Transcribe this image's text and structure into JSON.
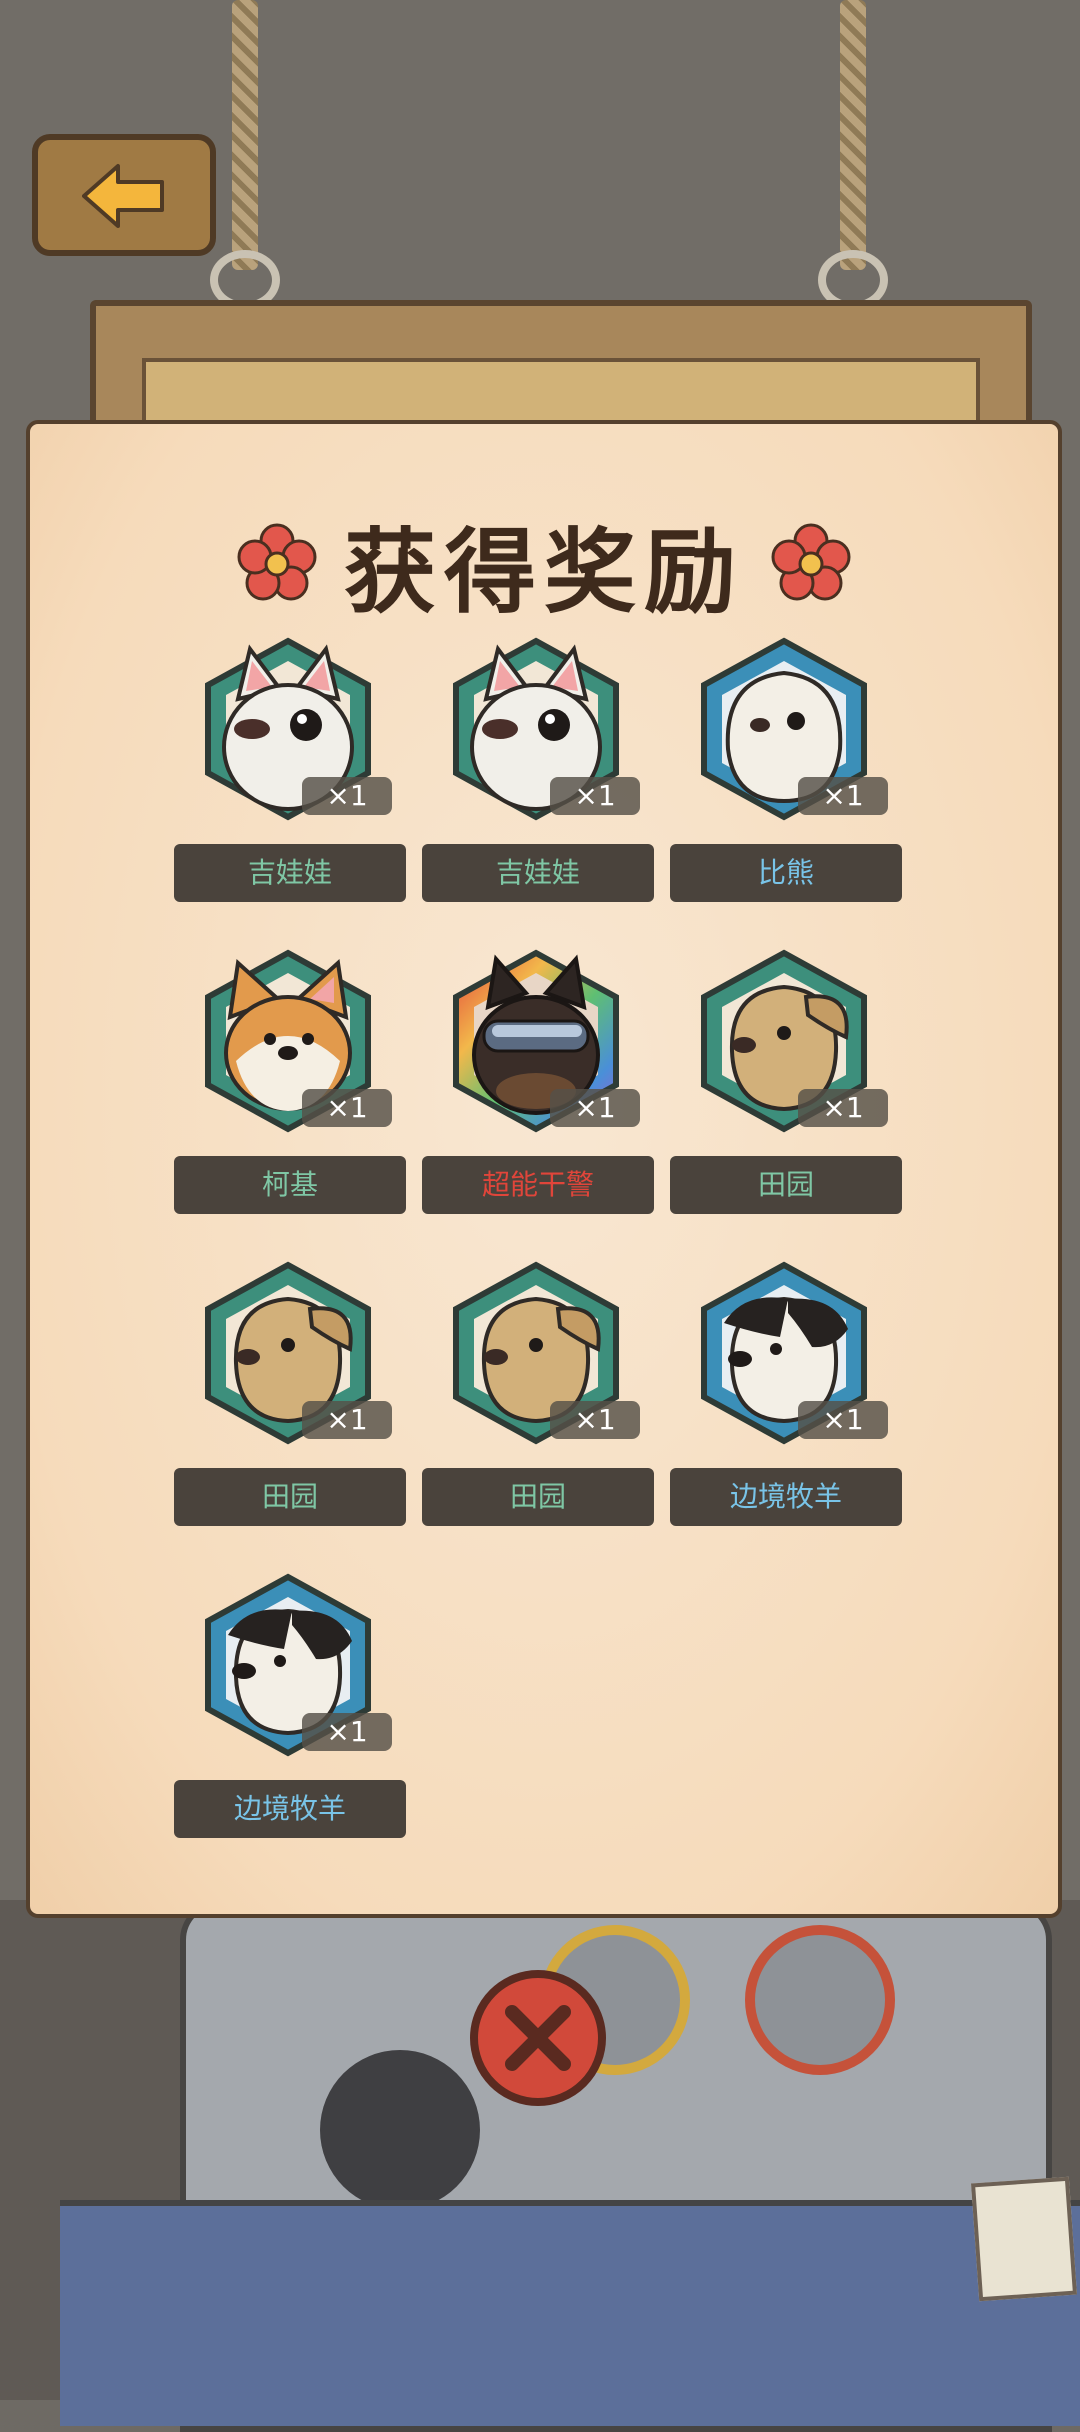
{
  "panel": {
    "title": "获得奖励"
  },
  "rewards": [
    {
      "name": "吉娃娃",
      "count": "×1",
      "name_color": "#7fc7a5",
      "frame": "#3d8f7c",
      "breed": "chihuahua"
    },
    {
      "name": "吉娃娃",
      "count": "×1",
      "name_color": "#7fc7a5",
      "frame": "#3d8f7c",
      "breed": "chihuahua"
    },
    {
      "name": "比熊",
      "count": "×1",
      "name_color": "#79c4e8",
      "frame": "#3b8fb8",
      "breed": "bichon"
    },
    {
      "name": "柯基",
      "count": "×1",
      "name_color": "#7fc7a5",
      "frame": "#3d8f7c",
      "breed": "corgi"
    },
    {
      "name": "超能干警",
      "count": "×1",
      "name_color": "#e0453a",
      "frame": "rainbow",
      "breed": "police-dog"
    },
    {
      "name": "田园",
      "count": "×1",
      "name_color": "#7fc7a5",
      "frame": "#3d8f7c",
      "breed": "rural-dog"
    },
    {
      "name": "田园",
      "count": "×1",
      "name_color": "#7fc7a5",
      "frame": "#3d8f7c",
      "breed": "rural-dog"
    },
    {
      "name": "田园",
      "count": "×1",
      "name_color": "#7fc7a5",
      "frame": "#3d8f7c",
      "breed": "rural-dog"
    },
    {
      "name": "边境牧羊",
      "count": "×1",
      "name_color": "#79c4e8",
      "frame": "#3b8fb8",
      "breed": "border-collie"
    },
    {
      "name": "边境牧羊",
      "count": "×1",
      "name_color": "#79c4e8",
      "frame": "#3b8fb8",
      "breed": "border-collie"
    }
  ],
  "icons": {
    "back": "left-arrow-icon",
    "close": "close-x-icon",
    "title_decoration": "flower-icon"
  }
}
